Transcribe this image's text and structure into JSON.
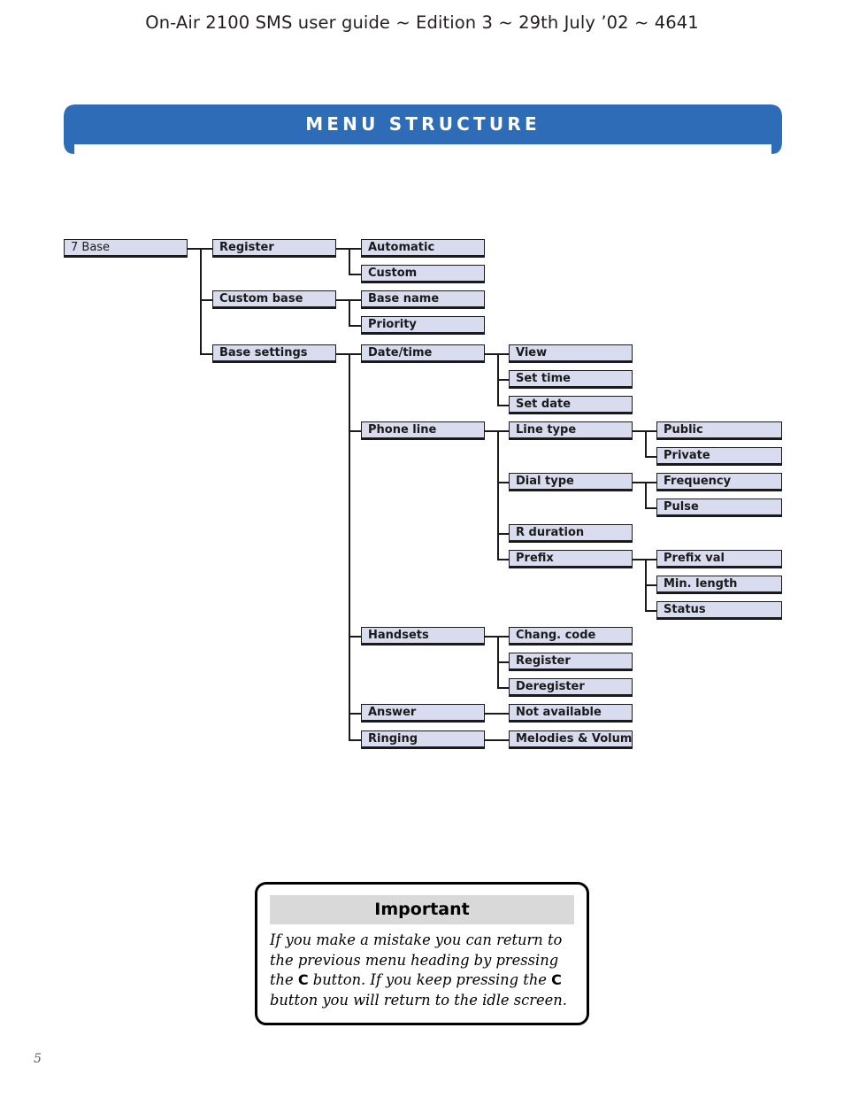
{
  "page": {
    "running_header": "On-Air 2100 SMS user guide ~ Edition 3 ~ 29th July ’02 ~ 4641",
    "folio": "5",
    "background_color": "#ffffff"
  },
  "banner": {
    "title": "MENU STRUCTURE",
    "fill_color": "#2e6cb8",
    "text_color": "#ffffff"
  },
  "diagram": {
    "node_fill": "#d9dcee",
    "node_border": "#1a1a1a",
    "nodes": {
      "base": "7 Base",
      "register": "Register",
      "automatic": "Automatic",
      "custom": "Custom",
      "custom_base": "Custom base",
      "base_name": "Base name",
      "priority": "Priority",
      "base_settings": "Base settings",
      "date_time": "Date/time",
      "view": "View",
      "set_time": "Set time",
      "set_date": "Set date",
      "phone_line": "Phone line",
      "line_type": "Line type",
      "public": "Public",
      "private": "Private",
      "dial_type": "Dial type",
      "frequency": "Frequency",
      "pulse": "Pulse",
      "r_duration": "R duration",
      "prefix": "Prefix",
      "prefix_val": "Prefix val",
      "min_length": "Min. length",
      "status": "Status",
      "handsets": "Handsets",
      "chang_code": "Chang. code",
      "register2": "Register",
      "deregister": "Deregister",
      "answer": "Answer",
      "not_available": "Not available",
      "ringing": "Ringing",
      "melodies_volume": "Melodies & Volume"
    }
  },
  "callout": {
    "heading": "Important",
    "header_bg": "#d9d9d9",
    "text_part_1": "If you make a mistake you can return to the previous menu heading by pressing the ",
    "key_1": "C",
    "text_part_2": " button. If you keep pressing the ",
    "key_2": "C",
    "text_part_3": " button you will return to the idle screen."
  }
}
